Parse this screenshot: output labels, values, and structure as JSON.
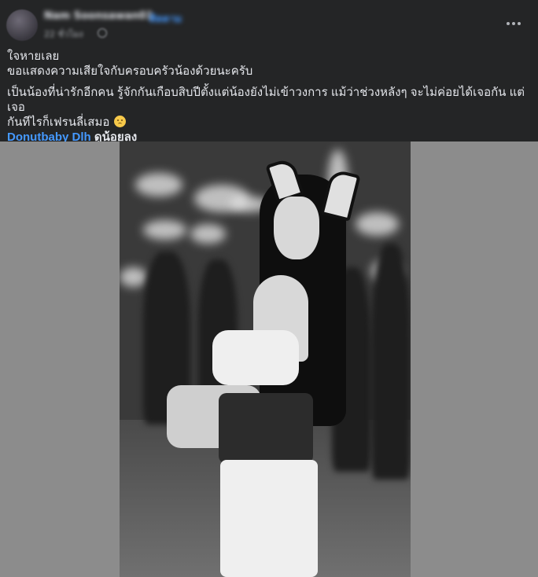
{
  "post": {
    "author_name": "Nam Soonsawan01",
    "follow_label": "ติดตาม",
    "timestamp": "22 ชั่วโมง",
    "more_icon": "more-horizontal-icon",
    "privacy_icon": "globe-icon",
    "text": {
      "line1": "ใจหายเลย",
      "line2": "ขอแสดงความเสียใจกับครอบครัวน้องด้วยนะครับ",
      "para2_line1": "เป็นน้องที่น่ารักอีกคน รู้จักกันเกือบสิบปีตั้งแต่น้องยังไม่เข้าวงการ แม้ว่าช่วงหลังๆ จะไม่ค่อยได้เจอกัน แต่เจอ",
      "para2_line2": "กันทีไรก็เฟรนลี่เสมอ",
      "emoji": "sad-face-emoji",
      "mention": "Donutbaby Dlh",
      "mention_suffix": "ดูน้อยลง"
    }
  },
  "colors": {
    "post_background": "#242526",
    "page_background": "#18191a",
    "link_blue": "#4599ff",
    "text_primary": "#e4e6eb",
    "text_secondary": "#b0b3b8",
    "media_letterbox": "#8c8c8c"
  }
}
